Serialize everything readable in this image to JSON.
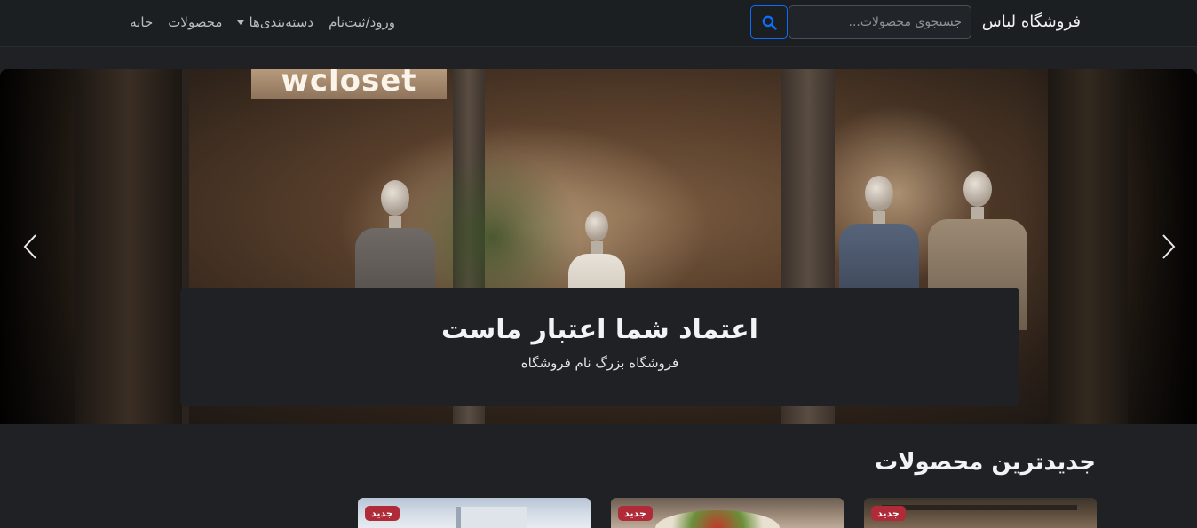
{
  "navbar": {
    "brand": "فروشگاه لباس",
    "search_placeholder": "جستجوی محصولات...",
    "links": {
      "home": "خانه",
      "products": "محصولات",
      "categories": "دسته‌بندی‌ها",
      "login": "ورود/ثبت‌نام"
    },
    "search_icon": "search-icon",
    "accent_color": "#0d6efd"
  },
  "hero": {
    "sign_text": "wcloset",
    "title": "اعتماد شما اعتبار ماست",
    "subtitle": "فروشگاه بزرگ نام فروشگاه",
    "prev_icon": "chevron-left-icon",
    "next_icon": "chevron-right-icon"
  },
  "products": {
    "section_title": "جدیدترین محصولات",
    "badge_color": "#b02a37",
    "cards": [
      {
        "badge": "جدید"
      },
      {
        "badge": "جدید"
      },
      {
        "badge": "جدید"
      }
    ]
  }
}
